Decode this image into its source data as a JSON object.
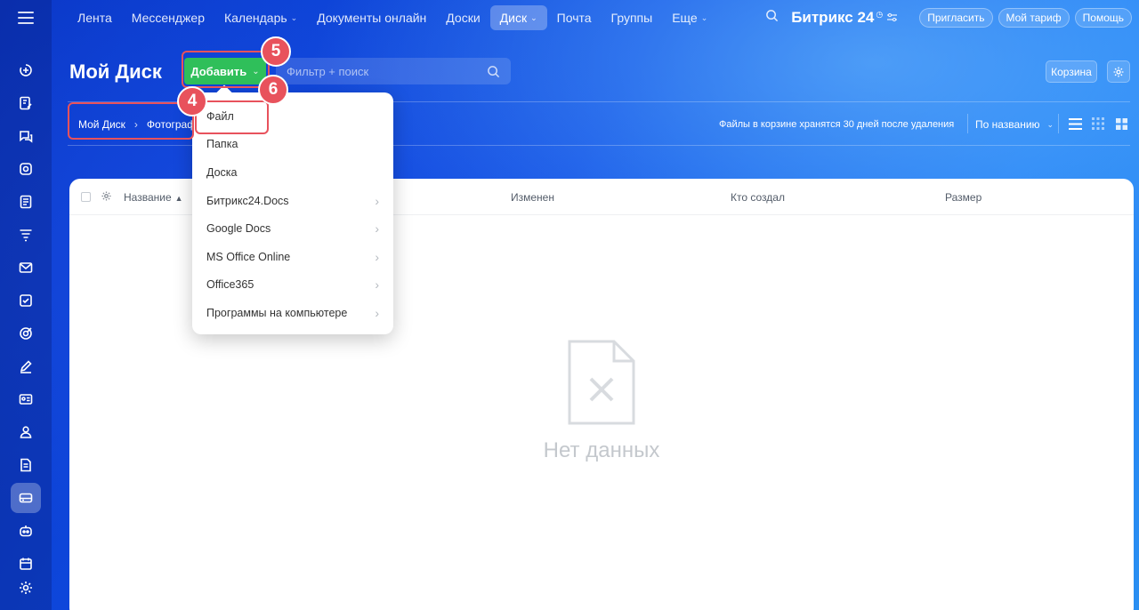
{
  "nav": {
    "items": [
      {
        "label": "Лента",
        "dropdown": false
      },
      {
        "label": "Мессенджер",
        "dropdown": false
      },
      {
        "label": "Календарь",
        "dropdown": true
      },
      {
        "label": "Документы онлайн",
        "dropdown": false
      },
      {
        "label": "Доски",
        "dropdown": false
      },
      {
        "label": "Диск",
        "dropdown": true,
        "active": true
      },
      {
        "label": "Почта",
        "dropdown": false
      },
      {
        "label": "Группы",
        "dropdown": false
      },
      {
        "label": "Еще",
        "dropdown": true
      }
    ],
    "brand": "Битрикс 24",
    "invite": "Пригласить",
    "tariff": "Мой тариф",
    "help": "Помощь"
  },
  "sidebar": {
    "icons": [
      "feed-icon",
      "tasks-edit-icon",
      "chat-icon",
      "calendar-icon",
      "documents-icon",
      "funnel-icon",
      "mail-icon",
      "checkbox-icon",
      "target-icon",
      "pen-icon",
      "contact-card-icon",
      "people-icon",
      "document-icon",
      "disk-icon",
      "robot-icon",
      "schedule-icon"
    ],
    "active_index": 13
  },
  "page": {
    "title": "Мой Диск",
    "add_button": "Добавить",
    "search_placeholder": "Фильтр + поиск",
    "trash_button": "Корзина"
  },
  "breadcrumb": {
    "root": "Мой Диск",
    "current": "Фотограф"
  },
  "toolbar": {
    "trash_note": "Файлы в корзине хранятся 30 дней после удаления",
    "sort": "По названию"
  },
  "table": {
    "columns": [
      "Название",
      "Изменен",
      "Кто создал",
      "Размер"
    ],
    "empty_text": "Нет данных"
  },
  "dropdown": {
    "items": [
      {
        "label": "Файл",
        "submenu": false
      },
      {
        "label": "Папка",
        "submenu": false
      },
      {
        "label": "Доска",
        "submenu": false
      },
      {
        "label": "Битрикс24.Docs",
        "submenu": true
      },
      {
        "label": "Google Docs",
        "submenu": true
      },
      {
        "label": "MS Office Online",
        "submenu": true
      },
      {
        "label": "Office365",
        "submenu": true
      },
      {
        "label": "Программы на компьютере",
        "submenu": true
      }
    ]
  },
  "markers": {
    "step4": "4",
    "step5": "5",
    "step6": "6"
  },
  "colors": {
    "accent_green": "#2fbf5a",
    "highlight_red": "#e8525c",
    "background_blue": "#0f4fe6"
  }
}
